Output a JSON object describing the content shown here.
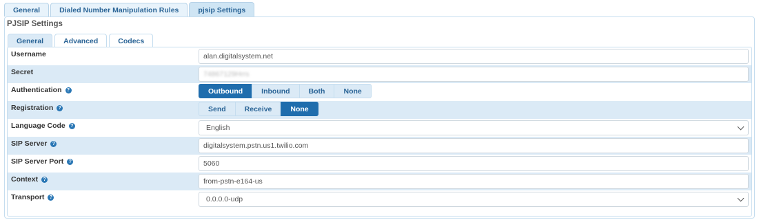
{
  "top_tabs": [
    {
      "label": "General",
      "active": false
    },
    {
      "label": "Dialed Number Manipulation Rules",
      "active": false
    },
    {
      "label": "pjsip Settings",
      "active": true
    }
  ],
  "panel_title": "PJSIP Settings",
  "sub_tabs": [
    {
      "label": "General",
      "active": true
    },
    {
      "label": "Advanced",
      "active": false
    },
    {
      "label": "Codecs",
      "active": false
    }
  ],
  "fields": {
    "username": {
      "label": "Username",
      "value": "alan.digitalsystem.net"
    },
    "secret": {
      "label": "Secret",
      "value": "74867129Hrrs"
    },
    "authentication": {
      "label": "Authentication",
      "options": [
        "Outbound",
        "Inbound",
        "Both",
        "None"
      ],
      "selected": "Outbound"
    },
    "registration": {
      "label": "Registration",
      "options": [
        "Send",
        "Receive",
        "None"
      ],
      "selected": "None"
    },
    "language_code": {
      "label": "Language Code",
      "value": "English"
    },
    "sip_server": {
      "label": "SIP Server",
      "value": "digitalsystem.pstn.us1.twilio.com"
    },
    "sip_server_port": {
      "label": "SIP Server Port",
      "value": "5060"
    },
    "context": {
      "label": "Context",
      "value": "from-pstn-e164-us"
    },
    "transport": {
      "label": "Transport",
      "value": "0.0.0.0-udp"
    }
  },
  "colors": {
    "accent": "#1f6dad",
    "row_alt": "#dbeaf6",
    "tab_text": "#2a6496"
  },
  "icons": {
    "help": "question-circle-icon",
    "dropdown": "chevron-down-icon"
  }
}
